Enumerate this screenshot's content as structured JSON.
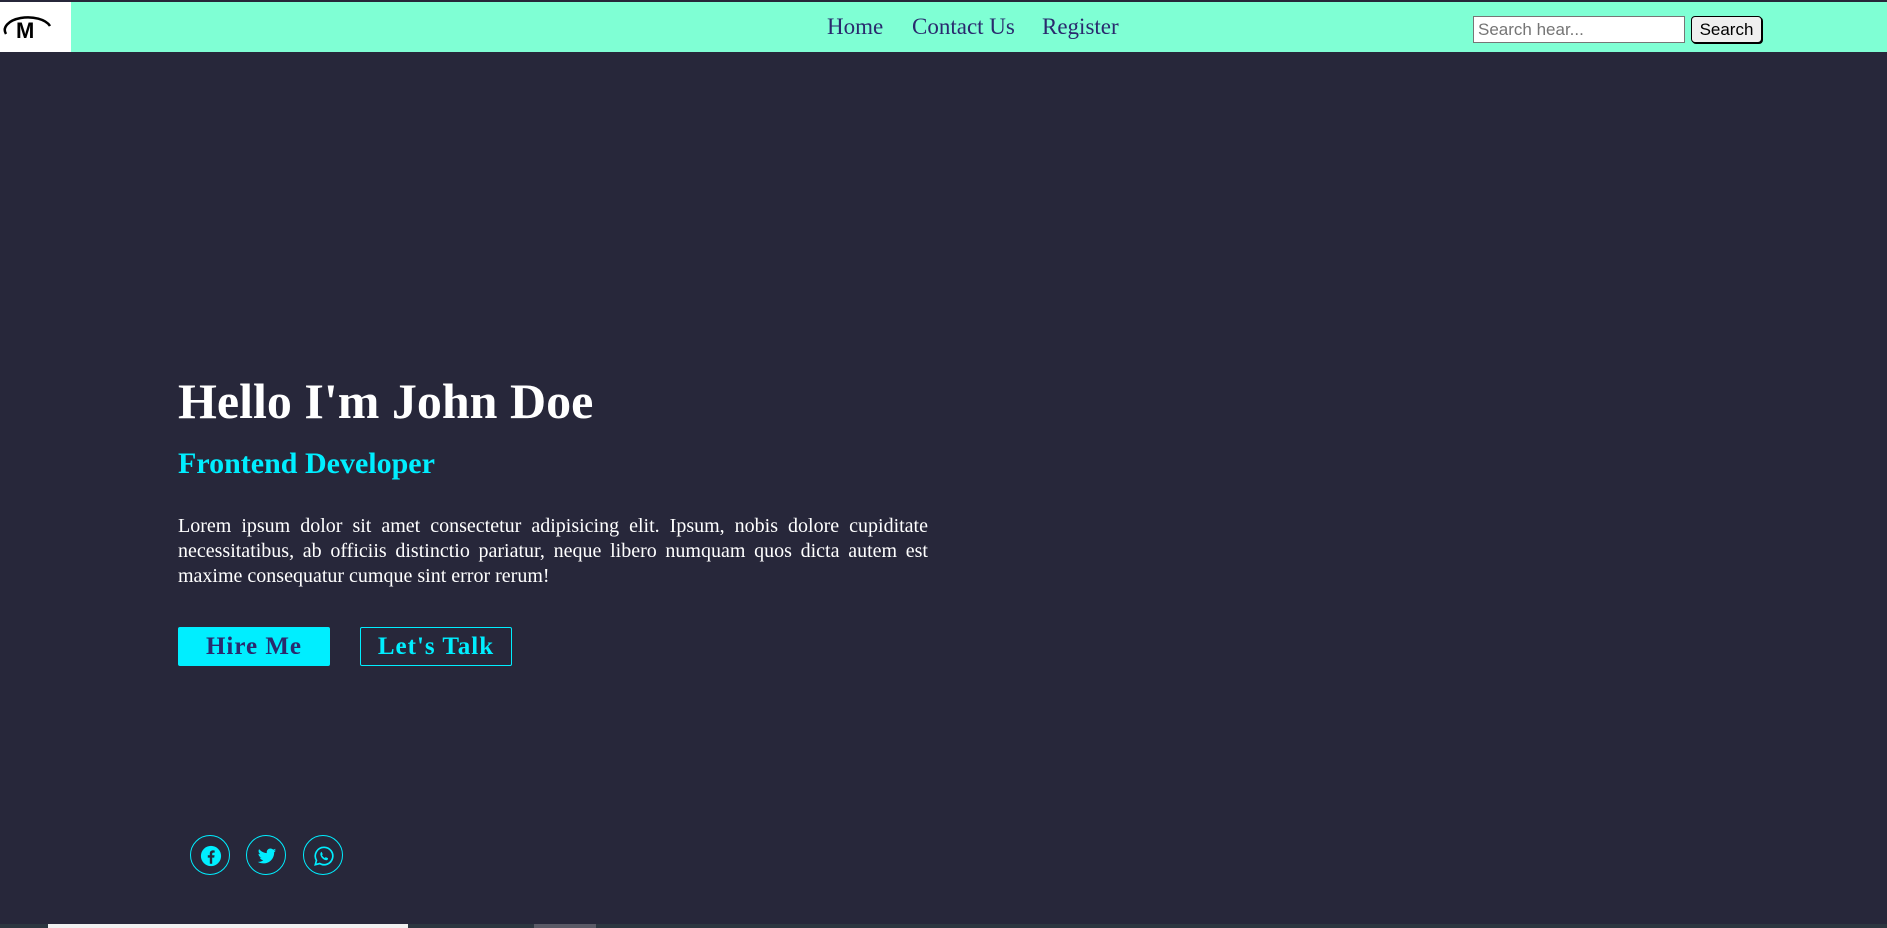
{
  "nav": {
    "links": [
      "Home",
      "Contact Us",
      "Register"
    ]
  },
  "search": {
    "placeholder": "Search hear...",
    "value": "",
    "button_label": "Search"
  },
  "hero": {
    "title": "Hello I'm John Doe",
    "subtitle": "Frontend Developer",
    "description": "Lorem ipsum dolor sit amet consectetur adipisicing elit. Ipsum, nobis dolore cupiditate necessitatibus, ab officiis distinctio pariatur, neque libero numquam quos dicta autem est maxime consequatur cumque sint error rerum!",
    "hire_label": "Hire Me",
    "talk_label": "Let's Talk"
  },
  "social": [
    "facebook-icon",
    "twitter-icon",
    "whatsapp-icon"
  ],
  "colors": {
    "navbar": "#7fffd4",
    "background": "#27273a",
    "accent": "#00eeff",
    "nav_text": "#2a2a6e"
  }
}
